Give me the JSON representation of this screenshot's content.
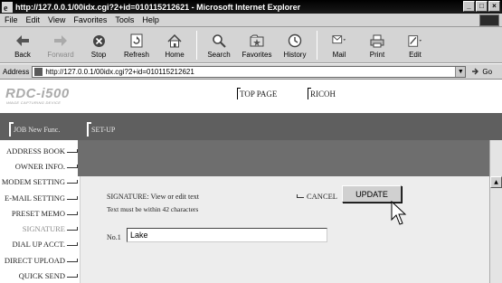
{
  "window": {
    "title": "http://127.0.0.1/00idx.cgi?2+id=010115212621 - Microsoft Internet Explorer",
    "controls": [
      "_",
      "□",
      "×"
    ]
  },
  "menu": [
    "File",
    "Edit",
    "View",
    "Favorites",
    "Tools",
    "Help"
  ],
  "toolbar": [
    {
      "label": "Back",
      "icon": "back-arrow-icon",
      "enabled": true
    },
    {
      "label": "Forward",
      "icon": "forward-arrow-icon",
      "enabled": false
    },
    {
      "label": "Stop",
      "icon": "stop-icon",
      "enabled": true
    },
    {
      "label": "Refresh",
      "icon": "refresh-icon",
      "enabled": true
    },
    {
      "label": "Home",
      "icon": "home-icon",
      "enabled": true
    },
    {
      "label": "Search",
      "icon": "search-icon",
      "enabled": true
    },
    {
      "label": "Favorites",
      "icon": "favorites-icon",
      "enabled": true
    },
    {
      "label": "History",
      "icon": "history-icon",
      "enabled": true
    },
    {
      "label": "Mail",
      "icon": "mail-icon",
      "enabled": true
    },
    {
      "label": "Print",
      "icon": "print-icon",
      "enabled": true
    },
    {
      "label": "Edit",
      "icon": "edit-icon",
      "enabled": true
    }
  ],
  "address": {
    "label": "Address",
    "value": "http://127.0.0.1/00idx.cgi?2+id=010115212621",
    "go_label": "Go"
  },
  "app": {
    "logo": "RDC-i500",
    "logo_sub": "IMAGE CAPTURING DEVICE",
    "header_links": [
      "TOP PAGE",
      "RICOH"
    ],
    "tabs": [
      "JOB New Func.",
      "SET-UP"
    ]
  },
  "nav": [
    {
      "label": "ADDRESS BOOK",
      "current": false
    },
    {
      "label": "OWNER INFO.",
      "current": false
    },
    {
      "label": "MODEM SETTING",
      "current": false
    },
    {
      "label": "E-MAIL SETTING",
      "current": false
    },
    {
      "label": "PRESET MEMO",
      "current": false
    },
    {
      "label": "SIGNATURE",
      "current": true
    },
    {
      "label": "DIAL UP ACCT.",
      "current": false
    },
    {
      "label": "DIRECT UPLOAD",
      "current": false
    },
    {
      "label": "QUICK SEND",
      "current": false
    }
  ],
  "form": {
    "heading": "SIGNATURE: View or edit text",
    "note": "Text must be within 42 characters",
    "cancel_label": "CANCEL",
    "update_label": "UPDATE",
    "field_label": "No.1",
    "field_value": "Lake"
  },
  "colors": {
    "band_dark": "#5f5f5f",
    "content_band": "#6e6e6e",
    "panel": "#ededed",
    "nav_current": "#8c8c8c"
  }
}
